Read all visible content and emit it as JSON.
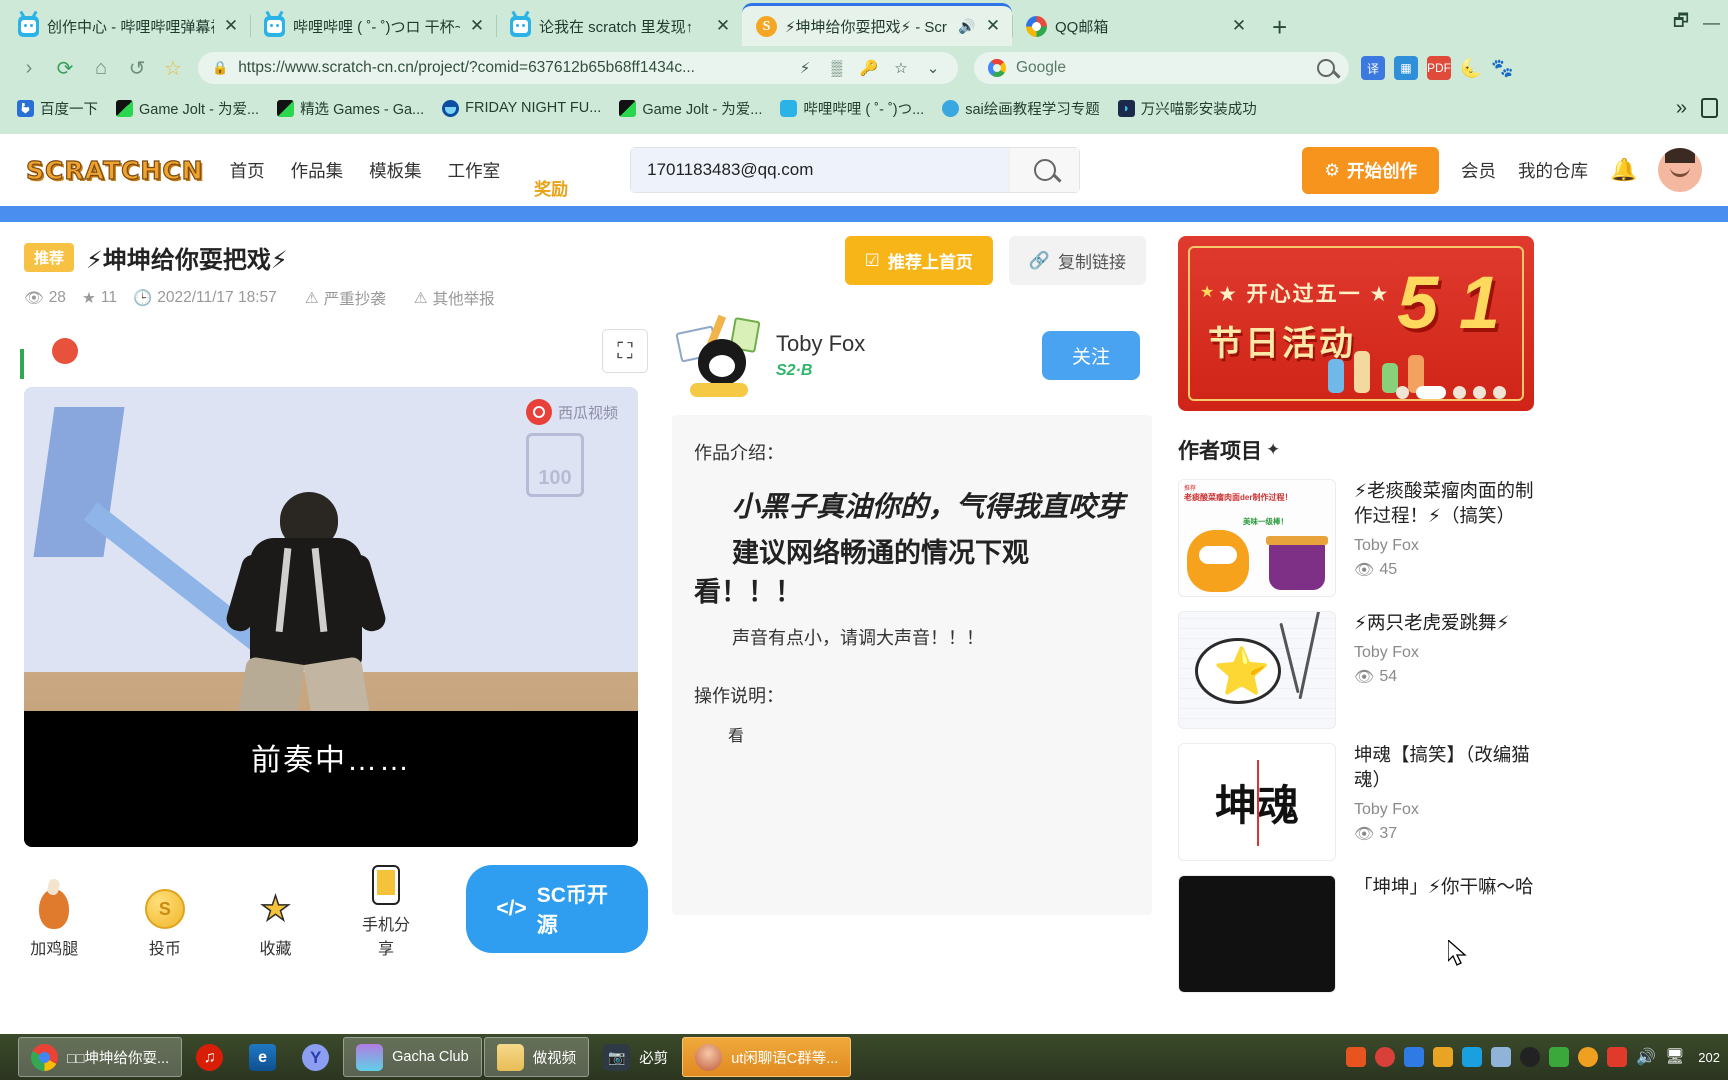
{
  "browser": {
    "tabs": [
      {
        "title": "创作中心 - 哔哩哔哩弹幕视",
        "favicon": "bilibili-icon",
        "active": false,
        "close": "✕"
      },
      {
        "title": "哔哩哔哩 ( ˚- ˚)つロ 干杯~",
        "favicon": "bilibili-icon",
        "active": false,
        "close": "✕"
      },
      {
        "title": "论我在 scratch 里发现↑",
        "favicon": "bilibili-icon",
        "active": false,
        "close": "✕"
      },
      {
        "title": "⚡坤坤给你耍把戏⚡ - Scr",
        "favicon": "scratch-icon",
        "active": true,
        "close": "✕",
        "audio": "🔊"
      },
      {
        "title": "QQ邮箱",
        "favicon": "qq-icon",
        "active": false,
        "close": "✕"
      }
    ],
    "newtab_label": "+",
    "window_controls": [
      "restore-icon",
      "minimize-icon"
    ],
    "toolbar": {
      "forward": "›",
      "reload": "⟳",
      "home": "⌂",
      "history": "↺",
      "bookmark_star": "☆",
      "lock": "🔒",
      "url": "https://www.scratch-cn.cn/project/?comid=637612b65b68ff1434c...",
      "icons": [
        "lightning-icon",
        "qrcode-icon",
        "key-icon",
        "star-icon",
        "chevron-down-icon"
      ],
      "search_engine": "Google",
      "right_icons": [
        "translate-icon",
        "apps-icon",
        "pdf-icon",
        "moon-icon",
        "cat-icon"
      ]
    },
    "bookmarks": [
      {
        "label": "百度一下",
        "icon": "baidu-icon"
      },
      {
        "label": "Game Jolt - 为爱...",
        "icon": "gamejolt-icon"
      },
      {
        "label": "精选 Games - Ga...",
        "icon": "gamejolt-icon"
      },
      {
        "label": "FRIDAY NIGHT FU...",
        "icon": "fnf-icon"
      },
      {
        "label": "Game Jolt - 为爱...",
        "icon": "gamejolt-icon"
      },
      {
        "label": "哔哩哔哩 ( ˚- ˚)つ...",
        "icon": "bilibili-icon"
      },
      {
        "label": "sai绘画教程学习专题",
        "icon": "sai-icon"
      },
      {
        "label": "万兴喵影安装成功",
        "icon": "wondershare-icon"
      }
    ],
    "bookmarks_overflow": "»"
  },
  "site": {
    "logo": "SCRATCHCN",
    "nav": [
      "首页",
      "作品集",
      "模板集",
      "工作室"
    ],
    "reward_label": "奖励",
    "search": {
      "value": "1701183483@qq.com",
      "placeholder": "搜索"
    },
    "create_button": "开始创作",
    "member_link": "会员",
    "repo_link": "我的仓库"
  },
  "project": {
    "badge": "推荐",
    "title": "⚡坤坤给你耍把戏⚡",
    "views": "28",
    "stars": "11",
    "date": "2022/11/17 18:57",
    "report_plagiarism": "严重抄袭",
    "report_other": "其他举报",
    "stage_caption": "前奏中……",
    "stage_watermark": "西瓜视频",
    "stage_badge": "100",
    "actions": [
      {
        "label": "加鸡腿",
        "icon": "chicken-leg-icon"
      },
      {
        "label": "投币",
        "icon": "coin-icon"
      },
      {
        "label": "收藏",
        "icon": "star-add-icon"
      },
      {
        "label": "手机分享",
        "icon": "phone-share-icon"
      }
    ],
    "sc_button": "SC币开源"
  },
  "detail": {
    "promote_button": "推荐上首页",
    "copy_link_button": "复制链接",
    "author_name": "Toby Fox",
    "author_level": "S2·B",
    "follow_button": "关注",
    "desc_label": "作品介绍：",
    "desc_line1": "小黑子真油你的，气得我直咬芽",
    "desc_line2": "建议网络畅通的情况下观看！！！",
    "desc_line3": "声音有点小，请调大声音！！！",
    "howto_label": "操作说明：",
    "howto_text": "看"
  },
  "promo": {
    "sub": "★ 开心过五一 ★",
    "title": "节日活动",
    "number": "5 1",
    "dots": [
      false,
      true,
      false,
      false,
      false
    ]
  },
  "sidebar": {
    "section_title": "作者项目",
    "sparkle": "✦",
    "projects": [
      {
        "name": "⚡老痰酸菜瘤肉面的制作过程！⚡（搞笑）",
        "author": "Toby Fox",
        "views": "45",
        "thumb": "noodle-cat-thumb",
        "thumb_text": "老痰酸菜瘤肉面der制作过程！",
        "thumb_sub": "美味一级棒！"
      },
      {
        "name": "⚡两只老虎爱跳舞⚡",
        "author": "Toby Fox",
        "views": "54",
        "thumb": "dancing-star-thumb"
      },
      {
        "name": "坤魂【搞笑】（改编猫魂）",
        "author": "Toby Fox",
        "views": "37",
        "thumb": "kunhun-thumb",
        "thumb_text": "坤魂"
      },
      {
        "name": "「坤坤」⚡你干嘛～哈",
        "author": "",
        "views": "",
        "thumb": "dark-thumb"
      }
    ]
  },
  "taskbar": {
    "items": [
      {
        "label": "□□坤坤给你耍...",
        "icon": "chrome-icon",
        "state": "selected"
      },
      {
        "label": "",
        "icon": "netease-music-icon",
        "state": "normal"
      },
      {
        "label": "",
        "icon": "edge-icon",
        "state": "normal"
      },
      {
        "label": "",
        "icon": "yy-icon",
        "state": "normal"
      },
      {
        "label": "Gacha Club",
        "icon": "gacha-club-icon",
        "state": "selected"
      },
      {
        "label": "做视频",
        "icon": "folder-icon",
        "state": "selected"
      },
      {
        "label": "必剪",
        "icon": "bijian-icon",
        "state": "normal"
      },
      {
        "label": "ut闲聊语C群等...",
        "icon": "ut-icon",
        "state": "highlighted"
      }
    ],
    "tray_icons": [
      "sogou-icon",
      "record-icon",
      "wps-icon",
      "usb-icon",
      "kugou-icon",
      "picture-icon",
      "qq-penguin-icon",
      "eject-icon",
      "flame-icon",
      "volume-mute-icon",
      "volume-icon",
      "network-icon"
    ],
    "clock": "202"
  }
}
